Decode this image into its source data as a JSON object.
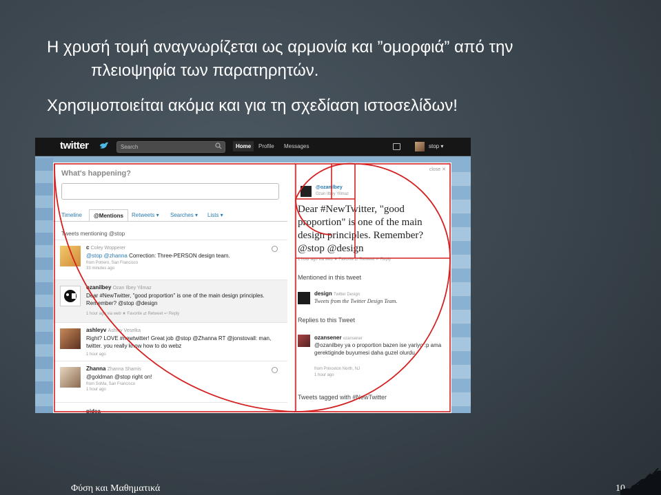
{
  "slide": {
    "line1": "Η χρυσή τομή αναγνωρίζεται ως αρμονία και ”ομορφιά” από την",
    "line2": "πλειοψηφία των παρατηρητών.",
    "line3": "Χρησιμοποιείται ακόμα και για τη σχεδίαση ιστοσελίδων!",
    "footer_left": "Φύση και Μαθηματικά",
    "page_number": "10"
  },
  "twitter": {
    "logo": "twitter",
    "search_placeholder": "Search",
    "nav": {
      "home": "Home",
      "profile": "Profile",
      "messages": "Messages"
    },
    "user": "stop ▾",
    "whats_happening": "What's happening?",
    "tabs": {
      "timeline": "Timeline",
      "mentions": "@Mentions",
      "retweets": "Retweets ▾",
      "searches": "Searches ▾",
      "lists": "Lists ▾"
    },
    "mentioning": "Tweets mentioning @stop",
    "tweets": [
      {
        "user": "c",
        "fullname": "Coley Wopperer",
        "text_mention1": "@stop",
        "text_mention2": "@zhanna",
        "text": " Correction: Three-PERSON design team.",
        "meta1": "from Potrero, San Francisco",
        "meta2": "33 minutes ago"
      },
      {
        "user": "ozanilbey",
        "fullname": "Ozan Ilbey Yilmaz",
        "text": "Dear #NewTwitter, \"good proportion\" is one of the main design principles. Remember? @stop @design",
        "meta1": "1 hour ago via web   ★ Favorite   ⇄ Retweet   ↩ Reply"
      },
      {
        "user": "ashleyv",
        "fullname": "Ashley Veselka",
        "text": "Right? LOVE #newtwitter! Great job @stop @Zhanna RT @jonstovall: man, twitter. you really know how to do webz",
        "meta1": "1 hour ago"
      },
      {
        "user": "Zhanna",
        "fullname": "Zhanna Shamis",
        "text": "@goldman @stop right on!",
        "meta1": "from SoMa, San Francisco",
        "meta2": "1 hour ago"
      },
      {
        "user": "pidea",
        "fullname": "",
        "text": "",
        "meta1": ""
      }
    ],
    "detail": {
      "close": "close ✕",
      "user": "@ozanilbey",
      "name": "Ozan Ilbey Yilmaz",
      "tweet": "Dear #NewTwitter, \"good proportion\" is one of the main design principles. Remember? @stop @design",
      "meta": "1 hour ago via web   ★ Favorite   ⇄ Retweet   ↩ Reply",
      "mentioned_heading": "Mentioned in this tweet",
      "design_user": "design",
      "design_name": "Twitter Design",
      "design_desc": "Tweets from the Twitter Design Team.",
      "replies_heading": "Replies to this Tweet",
      "reply_user": "ozansener",
      "reply_name": "ozansener",
      "reply_text": "@ozanilbey ya o proportion bazen ise yariyo :p ama gerektiginde buyumesi daha guzel olurdu.",
      "reply_meta1": "from Princeton North, NJ",
      "reply_meta2": "1 hour ago",
      "tagged": "Tweets tagged with #NewTwitter"
    }
  },
  "colors": {
    "golden_overlay": "#d42020",
    "link": "#2a7ab0",
    "topbar": "#161616"
  }
}
